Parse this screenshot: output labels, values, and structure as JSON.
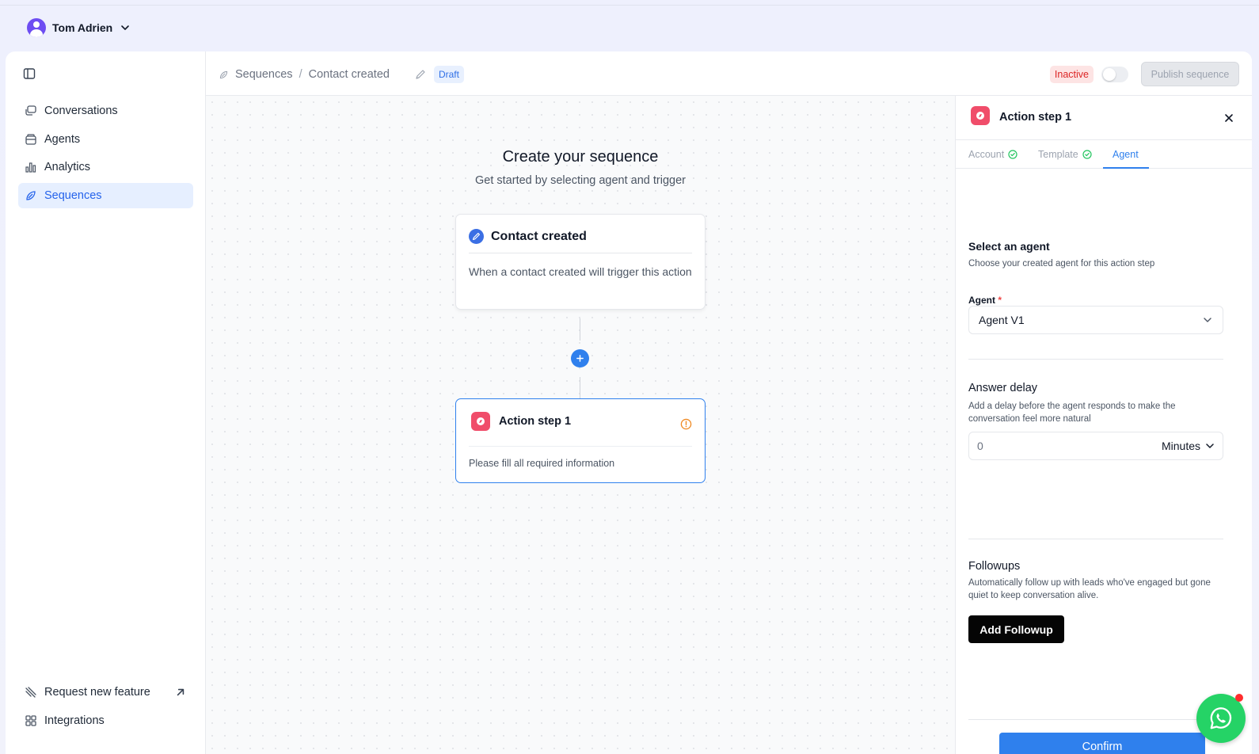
{
  "user": {
    "name": "Tom Adrien"
  },
  "sidebar": {
    "items": [
      {
        "label": "Conversations",
        "icon": "chat-icon"
      },
      {
        "label": "Agents",
        "icon": "agent-icon"
      },
      {
        "label": "Analytics",
        "icon": "bar-chart-icon"
      },
      {
        "label": "Sequences",
        "icon": "sequence-icon",
        "active": true
      }
    ],
    "bottom": [
      {
        "label": "Request new feature",
        "icon": "feature-icon"
      },
      {
        "label": "Integrations",
        "icon": "grid-icon"
      }
    ]
  },
  "header": {
    "breadcrumb_root": "Sequences",
    "breadcrumb_sep": "/",
    "breadcrumb_current": "Contact created",
    "status_badge": "Draft",
    "active_state": "Inactive",
    "publish_label": "Publish sequence"
  },
  "canvas": {
    "title": "Create your sequence",
    "subtitle": "Get started by selecting agent and trigger",
    "trigger": {
      "title": "Contact created",
      "description": "When a contact created will trigger this action"
    },
    "action": {
      "title": "Action step 1",
      "message": "Please fill all required information"
    }
  },
  "panel": {
    "title": "Action step 1",
    "tabs": [
      "Account",
      "Template",
      "Agent"
    ],
    "active_tab": "Agent",
    "agent_section": {
      "title": "Select an agent",
      "subtitle": "Choose your created agent for this action step",
      "field_label": "Agent",
      "required_mark": "*",
      "value": "Agent V1"
    },
    "delay_section": {
      "title": "Answer delay",
      "subtitle": "Add a delay before the agent responds to make the conversation feel more natural",
      "value": "0",
      "unit": "Minutes"
    },
    "followups_section": {
      "title": "Followups",
      "subtitle": "Automatically follow up with leads who've engaged but gone quiet to keep conversation alive.",
      "button_label": "Add Followup"
    },
    "confirm_label": "Confirm"
  },
  "colors": {
    "accent": "#2f80ed",
    "danger": "#dc2626",
    "action_icon": "#f04d6a",
    "whatsapp": "#25d366"
  }
}
